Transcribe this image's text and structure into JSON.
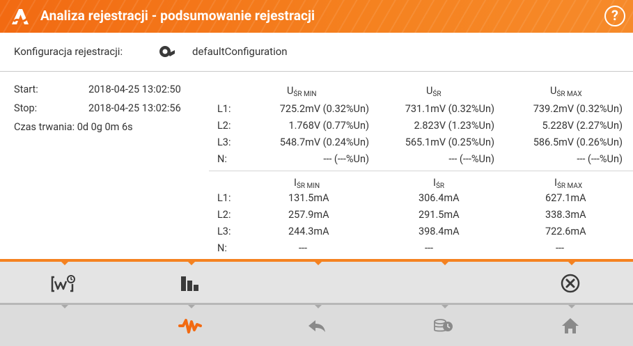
{
  "header": {
    "title": "Analiza rejestracji - podsumowanie rejestracji",
    "help_icon": "question-circle-icon",
    "help_glyph": "?"
  },
  "config": {
    "label": "Konfiguracja rejestracji:",
    "value": "defaultConfiguration",
    "icon": "configuration-gear-icon"
  },
  "info": {
    "start_label": "Start:",
    "start_value": "2018-04-25 13:02:50",
    "stop_label": "Stop:",
    "stop_value": "2018-04-25 13:02:56",
    "duration_label": "Czas trwania:",
    "duration_value": "0d 0g 0m 6s"
  },
  "voltage": {
    "headers": [
      {
        "main": "U",
        "sub": "ŚR MIN"
      },
      {
        "main": "U",
        "sub": "ŚR"
      },
      {
        "main": "U",
        "sub": "ŚR MAX"
      }
    ],
    "rows": [
      {
        "phase": "L1:",
        "min": "725.2mV (0.32%Un)",
        "avg": "731.1mV (0.32%Un)",
        "max": "739.2mV (0.32%Un)"
      },
      {
        "phase": "L2:",
        "min": "1.768V (0.77%Un)",
        "avg": "2.823V (1.23%Un)",
        "max": "5.228V (2.27%Un)"
      },
      {
        "phase": "L3:",
        "min": "548.7mV (0.24%Un)",
        "avg": "565.1mV (0.25%Un)",
        "max": "586.5mV (0.26%Un)"
      },
      {
        "phase": "N:",
        "min": "--- (---%Un)",
        "avg": "--- (---%Un)",
        "max": "--- (---%Un)"
      }
    ]
  },
  "current": {
    "headers": [
      {
        "main": "I",
        "sub": "ŚR MIN"
      },
      {
        "main": "I",
        "sub": "ŚR"
      },
      {
        "main": "I",
        "sub": "ŚR MAX"
      }
    ],
    "rows": [
      {
        "phase": "L1:",
        "min": "131.5mA",
        "avg": "306.4mA",
        "max": "627.1mA"
      },
      {
        "phase": "L2:",
        "min": "257.9mA",
        "avg": "291.5mA",
        "max": "338.3mA"
      },
      {
        "phase": "L3:",
        "min": "244.3mA",
        "avg": "398.4mA",
        "max": "722.6mA"
      },
      {
        "phase": "N:",
        "min": "---",
        "avg": "---",
        "max": "---"
      }
    ]
  },
  "toolbar_top": {
    "buttons": [
      "waveform-timer-icon",
      "bar-chart-icon",
      "close-circle-icon"
    ]
  },
  "toolbar_bottom": {
    "buttons": [
      "waveform-icon",
      "back-arrow-icon",
      "database-history-icon",
      "home-icon"
    ]
  },
  "colors": {
    "accent": "#f58220",
    "toolbar": "#e4e4e4",
    "toolbar_bottom": "#dcdcdc",
    "icon_dark": "#3a3a3a",
    "icon_muted": "#8a8a8a"
  }
}
